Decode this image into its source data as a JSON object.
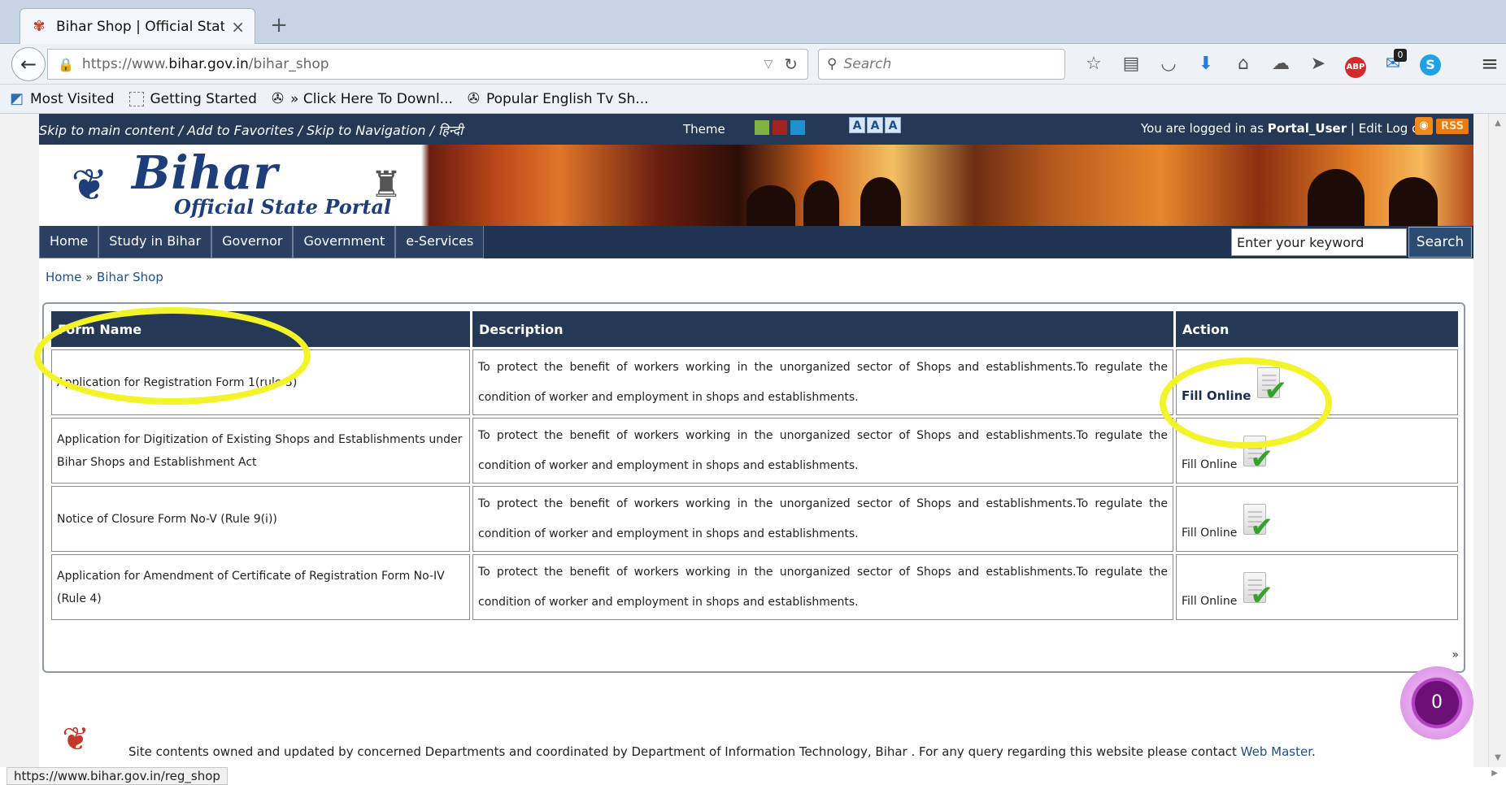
{
  "browser": {
    "tab_title": "Bihar Shop | Official State P...",
    "url_prefix": "https://www.",
    "url_domain": "bihar.gov.in",
    "url_path": "/bihar_shop",
    "search_placeholder": "Search",
    "notification_badge": "0",
    "bookmarks": [
      {
        "label": "Most Visited"
      },
      {
        "label": "Getting Started"
      },
      {
        "label": "» Click Here To Downl..."
      },
      {
        "label": "Popular English Tv Sh..."
      }
    ],
    "status_url": "https://www.bihar.gov.in/reg_shop"
  },
  "site": {
    "skip_links": "Skip to main content / Add to Favorites / Skip to Navigation / हिन्दी",
    "theme_label": "Theme",
    "theme_colors": [
      "#7fb241",
      "#a32323",
      "#1f8fcf"
    ],
    "font_sizes": [
      "A",
      "A",
      "A"
    ],
    "login_prefix": "You are logged in as",
    "login_user": "Portal_User",
    "login_links": "| Edit  Log out",
    "rss_label": "RSS",
    "logo_title": "Bihar",
    "logo_subtitle": "Official State Portal",
    "nav": [
      "Home",
      "Study in Bihar",
      "Governor",
      "Government",
      "e-Services"
    ],
    "search_placeholder": "Enter your keyword",
    "search_button": "Search"
  },
  "breadcrumb": {
    "home": "Home",
    "separator": "»",
    "current": "Bihar Shop"
  },
  "table": {
    "headers": [
      "Form Name",
      "Description",
      "Action"
    ],
    "rows": [
      {
        "name": "Application for Registration Form 1(rule 3)",
        "description": "To protect the benefit of workers working in the unorganized sector of Shops and establishments.To regulate the condition of worker and employment in shops and establishments.",
        "action": "Fill Online"
      },
      {
        "name": "Application for Digitization of Existing Shops and Establishments under Bihar Shops and Establishment Act",
        "description": "To protect the benefit of workers working in the unorganized sector of Shops and establishments.To regulate the condition of worker and employment in shops and establishments.",
        "action": "Fill Online"
      },
      {
        "name": "Notice of Closure Form No-V (Rule 9(i))",
        "description": "To protect the benefit of workers working in the unorganized sector of Shops and establishments.To regulate the condition of worker and employment in shops and establishments.",
        "action": "Fill Online"
      },
      {
        "name": "Application for Amendment of Certificate of Registration Form No-IV (Rule 4)",
        "description": "To protect the benefit of workers working in the unorganized sector of Shops and establishments.To regulate the condition of worker and employment in shops and establishments.",
        "action": "Fill Online"
      }
    ],
    "pager_next": "»"
  },
  "footer": {
    "text": "Site contents owned and updated by concerned Departments and coordinated by Department of Information Technology, Bihar . For any query regarding this website please contact",
    "link": "Web Master",
    "end": "."
  },
  "chat_bubble": {
    "count": "0"
  },
  "colors": {
    "header_navy": "#253856",
    "highlight_yellow": "#f3f32a",
    "link_blue": "#1e4f8a"
  }
}
